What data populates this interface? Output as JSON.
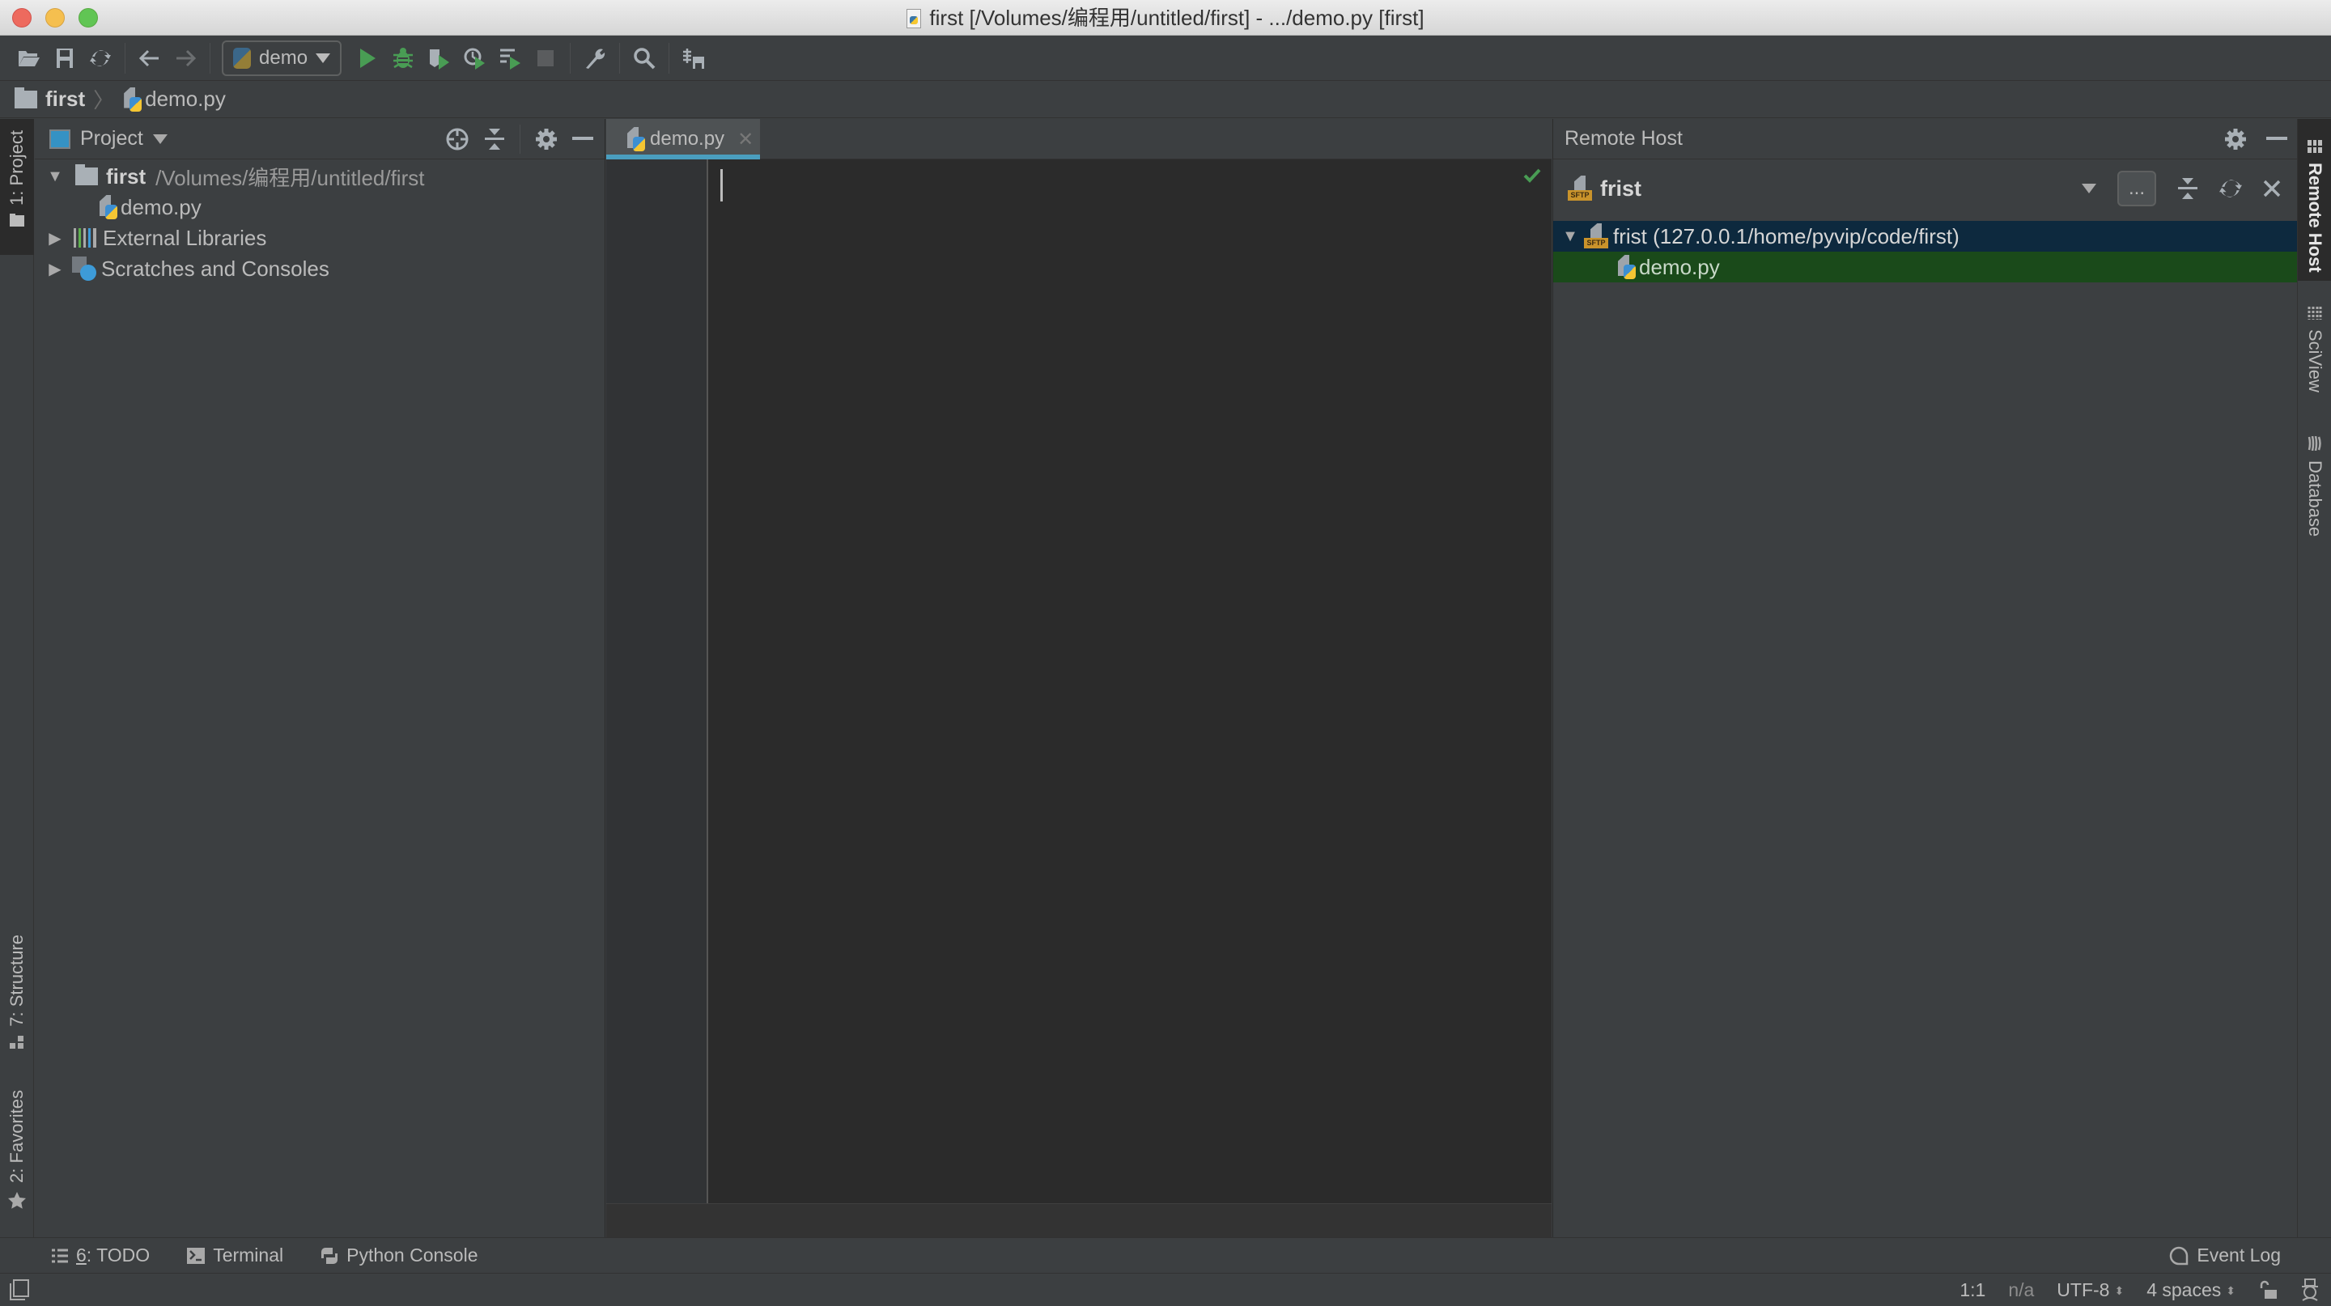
{
  "window": {
    "title": "first [/Volumes/编程用/untitled/first] - .../demo.py [first]"
  },
  "toolbar": {
    "run_config": "demo",
    "icons": [
      "open-folder-icon",
      "save-icon",
      "sync-icon",
      "back-icon",
      "forward-icon",
      "run-icon",
      "debug-icon",
      "run-with-coverage-icon",
      "profile-icon",
      "concurrency-icon",
      "stop-icon",
      "settings-wrench-icon",
      "search-icon",
      "remote-deploy-icon"
    ],
    "accent_run": "#499c54"
  },
  "breadcrumb": {
    "items": [
      "first",
      "demo.py"
    ]
  },
  "left_strip": {
    "tabs": [
      {
        "label": "1: Project",
        "active": true
      },
      {
        "label": "7: Structure",
        "active": false
      },
      {
        "label": "2: Favorites",
        "active": false
      }
    ]
  },
  "right_strip": {
    "tabs": [
      {
        "label": "Remote Host",
        "active": true
      },
      {
        "label": "SciView",
        "active": false
      },
      {
        "label": "Database",
        "active": false
      }
    ]
  },
  "project_panel": {
    "title": "Project",
    "tree": [
      {
        "name": "first",
        "path": "/Volumes/编程用/untitled/first",
        "expanded": true,
        "level": 0
      },
      {
        "name": "demo.py",
        "level": 1
      },
      {
        "name": "External Libraries",
        "expanded": false,
        "level": 0
      },
      {
        "name": "Scratches and Consoles",
        "expanded": false,
        "level": 0
      }
    ]
  },
  "editor": {
    "tabs": [
      {
        "label": "demo.py",
        "active": true
      }
    ],
    "content": "",
    "inspection_status": "ok"
  },
  "remote_panel": {
    "title": "Remote Host",
    "server": "frist",
    "more_button": "...",
    "tree": [
      {
        "name": "frist (127.0.0.1/home/pyvip/code/first)",
        "expanded": true,
        "selected": true
      },
      {
        "name": "demo.py",
        "highlighted": true
      }
    ],
    "colors": {
      "selected_bg": "#0d293e",
      "highlight_bg": "#1a4a1a"
    }
  },
  "bottom_bar": {
    "tabs": [
      {
        "label_prefix": "6",
        "label": ": TODO"
      },
      {
        "label": "Terminal"
      },
      {
        "label": "Python Console"
      }
    ],
    "event_log": "Event Log"
  },
  "status_bar": {
    "position": "1:1",
    "na": "n/a",
    "encoding": "UTF-8",
    "indent": "4 spaces"
  }
}
